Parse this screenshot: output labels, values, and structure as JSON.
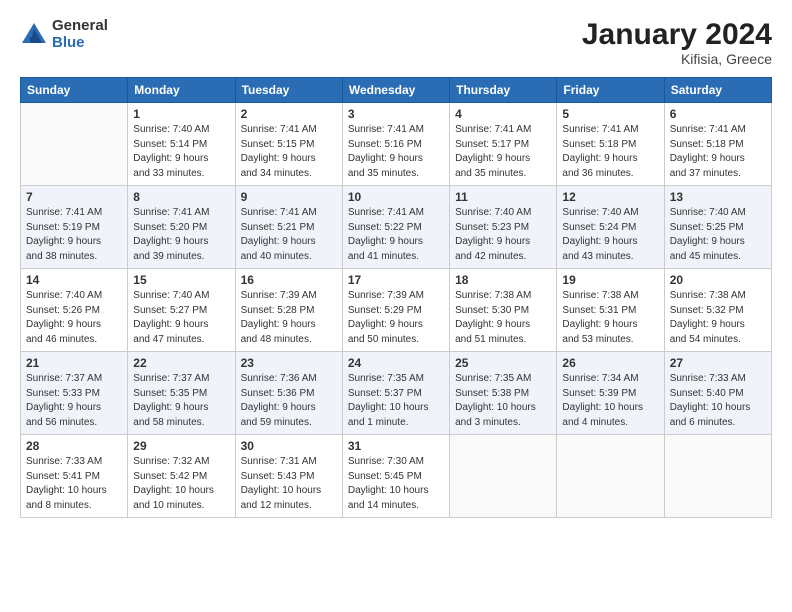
{
  "header": {
    "logo_general": "General",
    "logo_blue": "Blue",
    "title": "January 2024",
    "subtitle": "Kifisia, Greece"
  },
  "weekdays": [
    "Sunday",
    "Monday",
    "Tuesday",
    "Wednesday",
    "Thursday",
    "Friday",
    "Saturday"
  ],
  "weeks": [
    [
      {
        "day": "",
        "info": ""
      },
      {
        "day": "1",
        "info": "Sunrise: 7:40 AM\nSunset: 5:14 PM\nDaylight: 9 hours\nand 33 minutes."
      },
      {
        "day": "2",
        "info": "Sunrise: 7:41 AM\nSunset: 5:15 PM\nDaylight: 9 hours\nand 34 minutes."
      },
      {
        "day": "3",
        "info": "Sunrise: 7:41 AM\nSunset: 5:16 PM\nDaylight: 9 hours\nand 35 minutes."
      },
      {
        "day": "4",
        "info": "Sunrise: 7:41 AM\nSunset: 5:17 PM\nDaylight: 9 hours\nand 35 minutes."
      },
      {
        "day": "5",
        "info": "Sunrise: 7:41 AM\nSunset: 5:18 PM\nDaylight: 9 hours\nand 36 minutes."
      },
      {
        "day": "6",
        "info": "Sunrise: 7:41 AM\nSunset: 5:18 PM\nDaylight: 9 hours\nand 37 minutes."
      }
    ],
    [
      {
        "day": "7",
        "info": "Sunrise: 7:41 AM\nSunset: 5:19 PM\nDaylight: 9 hours\nand 38 minutes."
      },
      {
        "day": "8",
        "info": "Sunrise: 7:41 AM\nSunset: 5:20 PM\nDaylight: 9 hours\nand 39 minutes."
      },
      {
        "day": "9",
        "info": "Sunrise: 7:41 AM\nSunset: 5:21 PM\nDaylight: 9 hours\nand 40 minutes."
      },
      {
        "day": "10",
        "info": "Sunrise: 7:41 AM\nSunset: 5:22 PM\nDaylight: 9 hours\nand 41 minutes."
      },
      {
        "day": "11",
        "info": "Sunrise: 7:40 AM\nSunset: 5:23 PM\nDaylight: 9 hours\nand 42 minutes."
      },
      {
        "day": "12",
        "info": "Sunrise: 7:40 AM\nSunset: 5:24 PM\nDaylight: 9 hours\nand 43 minutes."
      },
      {
        "day": "13",
        "info": "Sunrise: 7:40 AM\nSunset: 5:25 PM\nDaylight: 9 hours\nand 45 minutes."
      }
    ],
    [
      {
        "day": "14",
        "info": "Sunrise: 7:40 AM\nSunset: 5:26 PM\nDaylight: 9 hours\nand 46 minutes."
      },
      {
        "day": "15",
        "info": "Sunrise: 7:40 AM\nSunset: 5:27 PM\nDaylight: 9 hours\nand 47 minutes."
      },
      {
        "day": "16",
        "info": "Sunrise: 7:39 AM\nSunset: 5:28 PM\nDaylight: 9 hours\nand 48 minutes."
      },
      {
        "day": "17",
        "info": "Sunrise: 7:39 AM\nSunset: 5:29 PM\nDaylight: 9 hours\nand 50 minutes."
      },
      {
        "day": "18",
        "info": "Sunrise: 7:38 AM\nSunset: 5:30 PM\nDaylight: 9 hours\nand 51 minutes."
      },
      {
        "day": "19",
        "info": "Sunrise: 7:38 AM\nSunset: 5:31 PM\nDaylight: 9 hours\nand 53 minutes."
      },
      {
        "day": "20",
        "info": "Sunrise: 7:38 AM\nSunset: 5:32 PM\nDaylight: 9 hours\nand 54 minutes."
      }
    ],
    [
      {
        "day": "21",
        "info": "Sunrise: 7:37 AM\nSunset: 5:33 PM\nDaylight: 9 hours\nand 56 minutes."
      },
      {
        "day": "22",
        "info": "Sunrise: 7:37 AM\nSunset: 5:35 PM\nDaylight: 9 hours\nand 58 minutes."
      },
      {
        "day": "23",
        "info": "Sunrise: 7:36 AM\nSunset: 5:36 PM\nDaylight: 9 hours\nand 59 minutes."
      },
      {
        "day": "24",
        "info": "Sunrise: 7:35 AM\nSunset: 5:37 PM\nDaylight: 10 hours\nand 1 minute."
      },
      {
        "day": "25",
        "info": "Sunrise: 7:35 AM\nSunset: 5:38 PM\nDaylight: 10 hours\nand 3 minutes."
      },
      {
        "day": "26",
        "info": "Sunrise: 7:34 AM\nSunset: 5:39 PM\nDaylight: 10 hours\nand 4 minutes."
      },
      {
        "day": "27",
        "info": "Sunrise: 7:33 AM\nSunset: 5:40 PM\nDaylight: 10 hours\nand 6 minutes."
      }
    ],
    [
      {
        "day": "28",
        "info": "Sunrise: 7:33 AM\nSunset: 5:41 PM\nDaylight: 10 hours\nand 8 minutes."
      },
      {
        "day": "29",
        "info": "Sunrise: 7:32 AM\nSunset: 5:42 PM\nDaylight: 10 hours\nand 10 minutes."
      },
      {
        "day": "30",
        "info": "Sunrise: 7:31 AM\nSunset: 5:43 PM\nDaylight: 10 hours\nand 12 minutes."
      },
      {
        "day": "31",
        "info": "Sunrise: 7:30 AM\nSunset: 5:45 PM\nDaylight: 10 hours\nand 14 minutes."
      },
      {
        "day": "",
        "info": ""
      },
      {
        "day": "",
        "info": ""
      },
      {
        "day": "",
        "info": ""
      }
    ]
  ]
}
